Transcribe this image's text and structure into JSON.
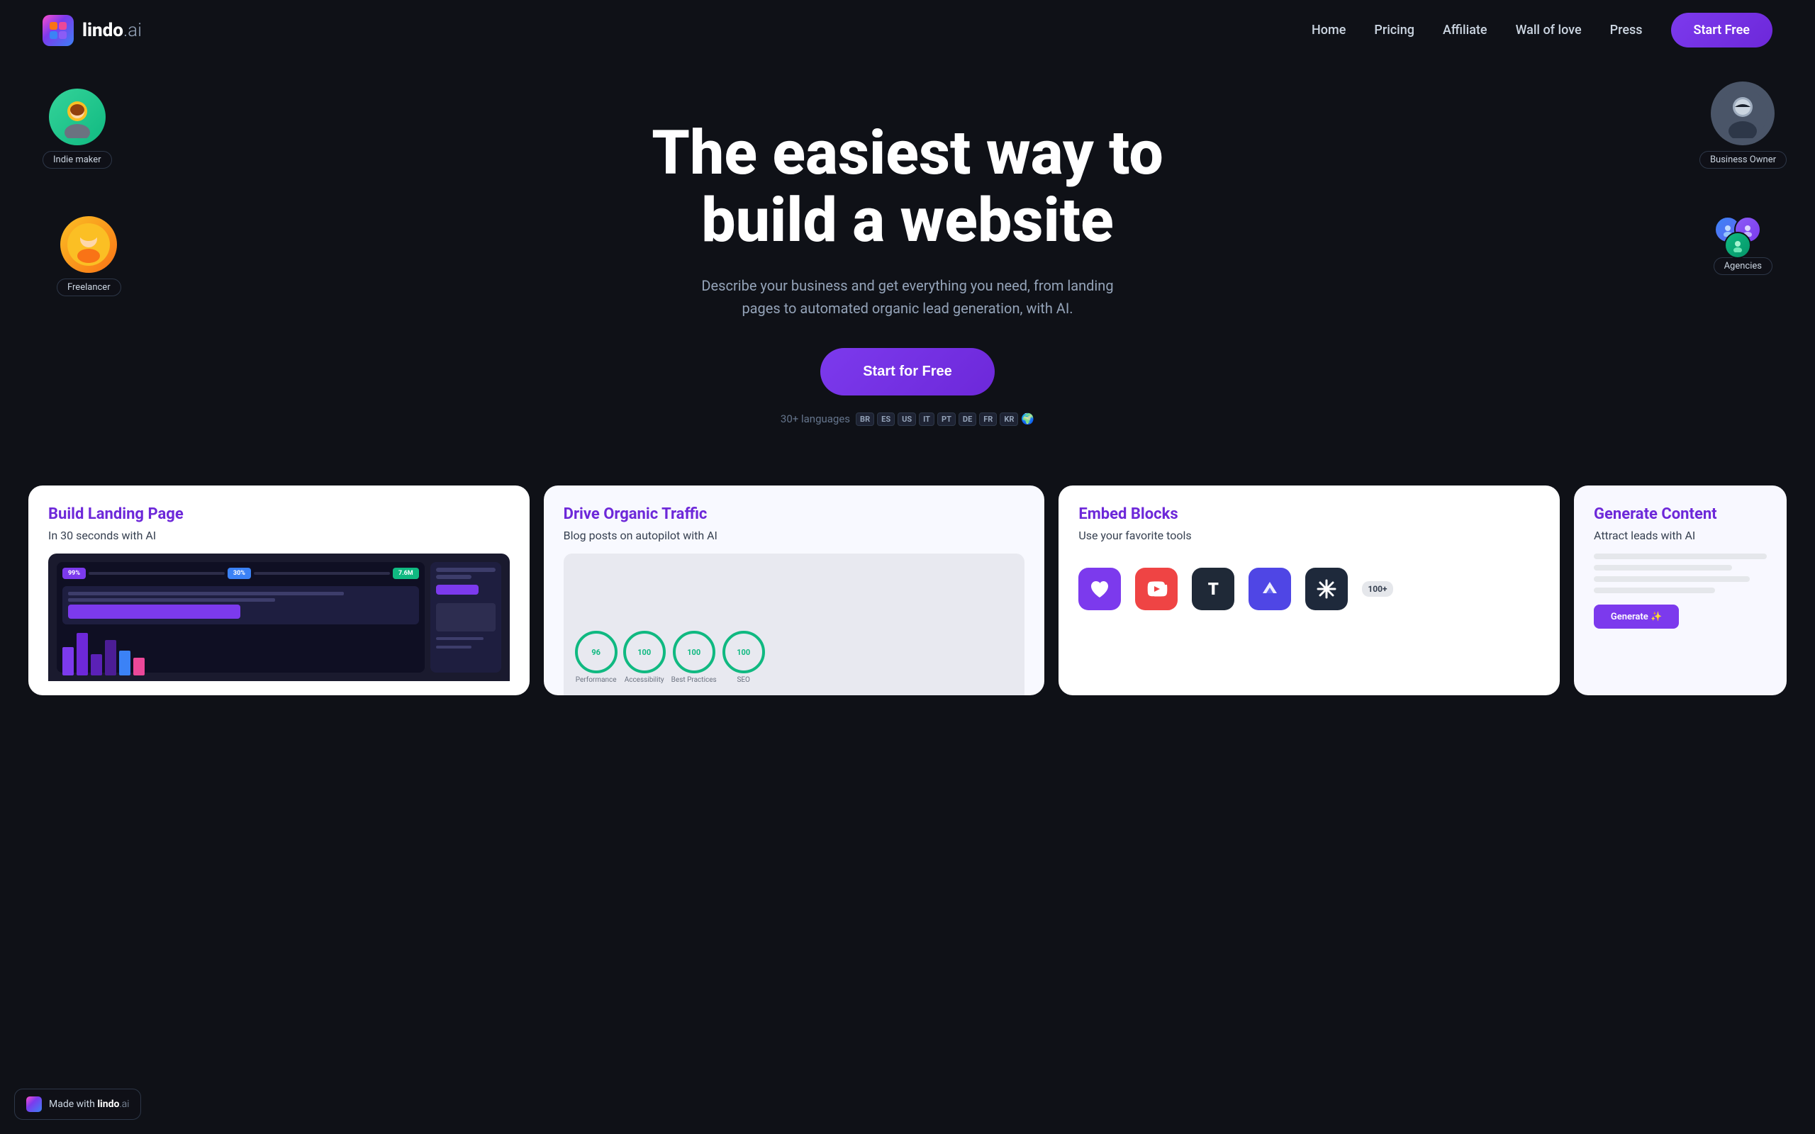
{
  "nav": {
    "logo_text_bold": "lindo",
    "logo_text_light": ".ai",
    "links": [
      {
        "label": "Home",
        "id": "home"
      },
      {
        "label": "Pricing",
        "id": "pricing"
      },
      {
        "label": "Affiliate",
        "id": "affiliate"
      },
      {
        "label": "Wall of love",
        "id": "wall-of-love"
      },
      {
        "label": "Press",
        "id": "press"
      }
    ],
    "cta": "Start Free"
  },
  "hero": {
    "title": "The easiest way to build a website",
    "subtitle": "Describe your business and get everything you need, from landing pages to automated organic lead generation, with AI.",
    "cta": "Start for Free",
    "languages_prefix": "30+ languages",
    "languages": [
      "BR",
      "ES",
      "US",
      "IT",
      "PT",
      "DE",
      "FR",
      "KR"
    ],
    "avatars": [
      {
        "id": "indie-maker",
        "label": "Indie maker",
        "position": "top-left",
        "emoji": "👨"
      },
      {
        "id": "freelancer",
        "label": "Freelancer",
        "position": "mid-left",
        "emoji": "👩"
      },
      {
        "id": "business-owner",
        "label": "Business Owner",
        "position": "top-right",
        "emoji": "👨‍💼"
      },
      {
        "id": "agencies",
        "label": "Agencies",
        "position": "mid-right"
      }
    ]
  },
  "features": [
    {
      "id": "landing-page",
      "title": "Build Landing Page",
      "subtitle": "In 30 seconds with AI"
    },
    {
      "id": "organic-traffic",
      "title": "Drive Organic Traffic",
      "subtitle": "Blog posts on autopilot with AI",
      "metrics": [
        "Performance",
        "Accessibility",
        "Best Practices",
        "SEO"
      ],
      "scores": [
        96,
        100,
        100,
        100
      ]
    },
    {
      "id": "embed-blocks",
      "title": "Embed Blocks",
      "subtitle": "Use your favorite tools",
      "plus_count": "100+"
    },
    {
      "id": "generate-content",
      "title": "Generate Content",
      "subtitle": "Attract leads with AI"
    }
  ],
  "made_with": {
    "label": "Made with",
    "brand_bold": "lindo",
    "brand_light": ".ai"
  },
  "colors": {
    "bg": "#0f1117",
    "accent_purple": "#7c3aed",
    "accent_blue": "#3b82f6",
    "nav_link": "#cbd5e1",
    "subtitle": "#94a3b8"
  }
}
